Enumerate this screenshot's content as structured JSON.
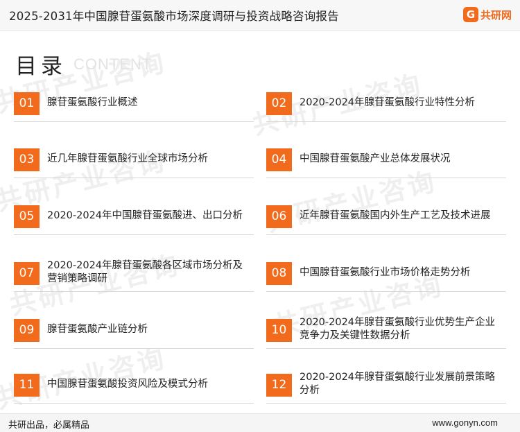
{
  "header": {
    "title": "2025-2031年中国腺苷蛋氨酸市场深度调研与投资战略咨询报告",
    "logo_mark": "G",
    "logo_text": "共研网"
  },
  "watermark": {
    "text": "共研产业咨询",
    "url": "www.gonyn.com"
  },
  "toc": {
    "title": "目录",
    "subtitle": "CONTENT",
    "items": [
      {
        "num": "01",
        "label": "腺苷蛋氨酸行业概述"
      },
      {
        "num": "02",
        "label": "2020-2024年腺苷蛋氨酸行业特性分析"
      },
      {
        "num": "03",
        "label": "近几年腺苷蛋氨酸行业全球市场分析"
      },
      {
        "num": "04",
        "label": "中国腺苷蛋氨酸产业总体发展状况"
      },
      {
        "num": "05",
        "label": "2020-2024年中国腺苷蛋氨酸进、出口分析"
      },
      {
        "num": "06",
        "label": "近年腺苷蛋氨酸国内外生产工艺及技术进展"
      },
      {
        "num": "07",
        "label": "2020-2024年腺苷蛋氨酸各区域市场分析及营销策略调研"
      },
      {
        "num": "08",
        "label": "中国腺苷蛋氨酸行业市场价格走势分析"
      },
      {
        "num": "09",
        "label": "腺苷蛋氨酸产业链分析"
      },
      {
        "num": "10",
        "label": "2020-2024年腺苷蛋氨酸行业优势生产企业竞争力及关键性数据分析"
      },
      {
        "num": "11",
        "label": "中国腺苷蛋氨酸投资风险及模式分析"
      },
      {
        "num": "12",
        "label": "2020-2024年腺苷蛋氨酸行业发展前景策略分析"
      }
    ]
  },
  "footer": {
    "left": "共研出品，必属精品",
    "right": "www.gonyn.com"
  }
}
